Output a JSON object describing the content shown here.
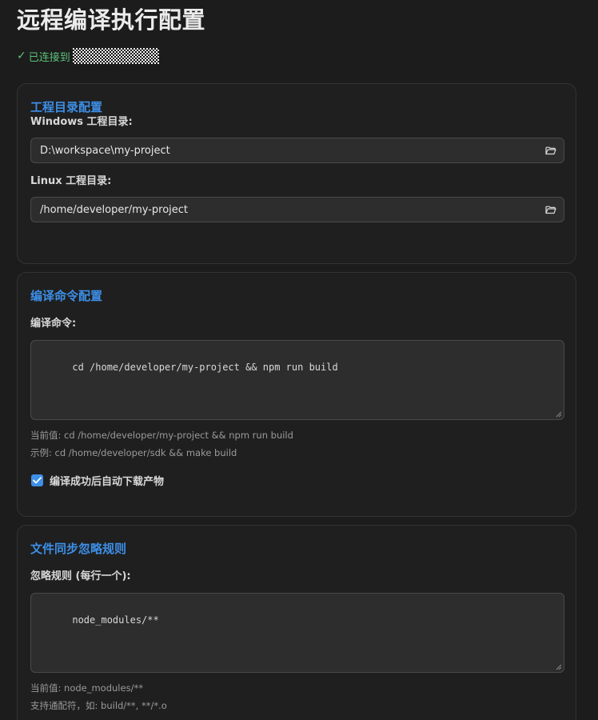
{
  "page": {
    "title": "远程编译执行配置",
    "status_check": "✓",
    "status_text": "已连接到"
  },
  "directories": {
    "title": "工程目录配置",
    "windows_label": "Windows 工程目录:",
    "windows_value": "D:\\workspace\\my-project",
    "linux_label": "Linux 工程目录:",
    "linux_value": "/home/developer/my-project"
  },
  "build": {
    "title": "编译命令配置",
    "command_label": "编译命令:",
    "command_value": "cd /home/developer/my-project && npm run build",
    "current_hint": "当前值: cd /home/developer/my-project && npm run build",
    "example_hint": "示例: cd /home/developer/sdk && make build",
    "auto_download_label": "编译成功后自动下载产物",
    "auto_download_checked": true
  },
  "ignore": {
    "title": "文件同步忽略规则",
    "rules_label": "忽略规则 (每行一个):",
    "rules_value": "node_modules/**",
    "current_hint": "当前值: node_modules/**",
    "wildcard_hint": "支持通配符，如: build/**, **/*.o"
  },
  "icons": {
    "folder": "folder-open-icon",
    "check": "checkmark-icon"
  },
  "colors": {
    "accent": "#3d8fe8",
    "success": "#5cc27a",
    "background": "#1c1c1c"
  }
}
